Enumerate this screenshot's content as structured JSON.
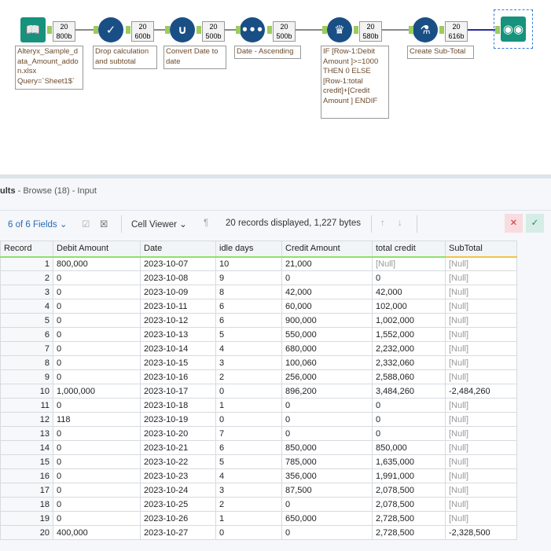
{
  "workflow": {
    "tools": [
      {
        "name": "input",
        "icon": "book-icon",
        "count": "20",
        "size": "800b",
        "label": "Alteryx_Sample_d ata_Amount_addo n.xlsx Query=`Sheet1$`"
      },
      {
        "name": "select",
        "icon": "checkmark-icon",
        "count": "20",
        "size": "600b",
        "label": "Drop calculation and subtotal"
      },
      {
        "name": "formula",
        "icon": "beaker-icon",
        "count": "20",
        "size": "500b",
        "label": "Convert Date to date"
      },
      {
        "name": "sort",
        "icon": "dots-icon",
        "count": "20",
        "size": "500b",
        "label": "Date - Ascending"
      },
      {
        "name": "multirow",
        "icon": "multi-row-icon",
        "count": "20",
        "size": "580b",
        "label": "IF [Row-1:Debit Amount ]>=1000 THEN 0 ELSE [Row-1:total credit]+[Credit Amount ] ENDIF"
      },
      {
        "name": "multirow2",
        "icon": "flask-icon",
        "count": "20",
        "size": "616b",
        "label": "Create Sub-Total"
      }
    ],
    "browse_icon": "binoculars-icon"
  },
  "results": {
    "title_bold": "ults",
    "title_rest": " - Browse (18) - Input",
    "fields": "6 of 6 Fields ⌄",
    "cell_viewer": "Cell Viewer ⌄",
    "status": "20 records displayed, 1,227 bytes",
    "columns": [
      "Record",
      "Debit Amount",
      "Date",
      "idle days",
      "Credit Amount",
      "total credit",
      "SubTotal"
    ],
    "rows": [
      [
        "1",
        "800,000",
        "2023-10-07",
        "10",
        "21,000",
        "[Null]",
        "[Null]"
      ],
      [
        "2",
        "0",
        "2023-10-08",
        "9",
        "0",
        "0",
        "[Null]"
      ],
      [
        "3",
        "0",
        "2023-10-09",
        "8",
        "42,000",
        "42,000",
        "[Null]"
      ],
      [
        "4",
        "0",
        "2023-10-11",
        "6",
        "60,000",
        "102,000",
        "[Null]"
      ],
      [
        "5",
        "0",
        "2023-10-12",
        "6",
        "900,000",
        "1,002,000",
        "[Null]"
      ],
      [
        "6",
        "0",
        "2023-10-13",
        "5",
        "550,000",
        "1,552,000",
        "[Null]"
      ],
      [
        "7",
        "0",
        "2023-10-14",
        "4",
        "680,000",
        "2,232,000",
        "[Null]"
      ],
      [
        "8",
        "0",
        "2023-10-15",
        "3",
        "100,060",
        "2,332,060",
        "[Null]"
      ],
      [
        "9",
        "0",
        "2023-10-16",
        "2",
        "256,000",
        "2,588,060",
        "[Null]"
      ],
      [
        "10",
        "1,000,000",
        "2023-10-17",
        "0",
        "896,200",
        "3,484,260",
        "-2,484,260"
      ],
      [
        "11",
        "0",
        "2023-10-18",
        "1",
        "0",
        "0",
        "[Null]"
      ],
      [
        "12",
        "118",
        "2023-10-19",
        "0",
        "0",
        "0",
        "[Null]"
      ],
      [
        "13",
        "0",
        "2023-10-20",
        "7",
        "0",
        "0",
        "[Null]"
      ],
      [
        "14",
        "0",
        "2023-10-21",
        "6",
        "850,000",
        "850,000",
        "[Null]"
      ],
      [
        "15",
        "0",
        "2023-10-22",
        "5",
        "785,000",
        "1,635,000",
        "[Null]"
      ],
      [
        "16",
        "0",
        "2023-10-23",
        "4",
        "356,000",
        "1,991,000",
        "[Null]"
      ],
      [
        "17",
        "0",
        "2023-10-24",
        "3",
        "87,500",
        "2,078,500",
        "[Null]"
      ],
      [
        "18",
        "0",
        "2023-10-25",
        "2",
        "0",
        "2,078,500",
        "[Null]"
      ],
      [
        "19",
        "0",
        "2023-10-26",
        "1",
        "650,000",
        "2,728,500",
        "[Null]"
      ],
      [
        "20",
        "400,000",
        "2023-10-27",
        "0",
        "0",
        "2,728,500",
        "-2,328,500"
      ]
    ]
  }
}
